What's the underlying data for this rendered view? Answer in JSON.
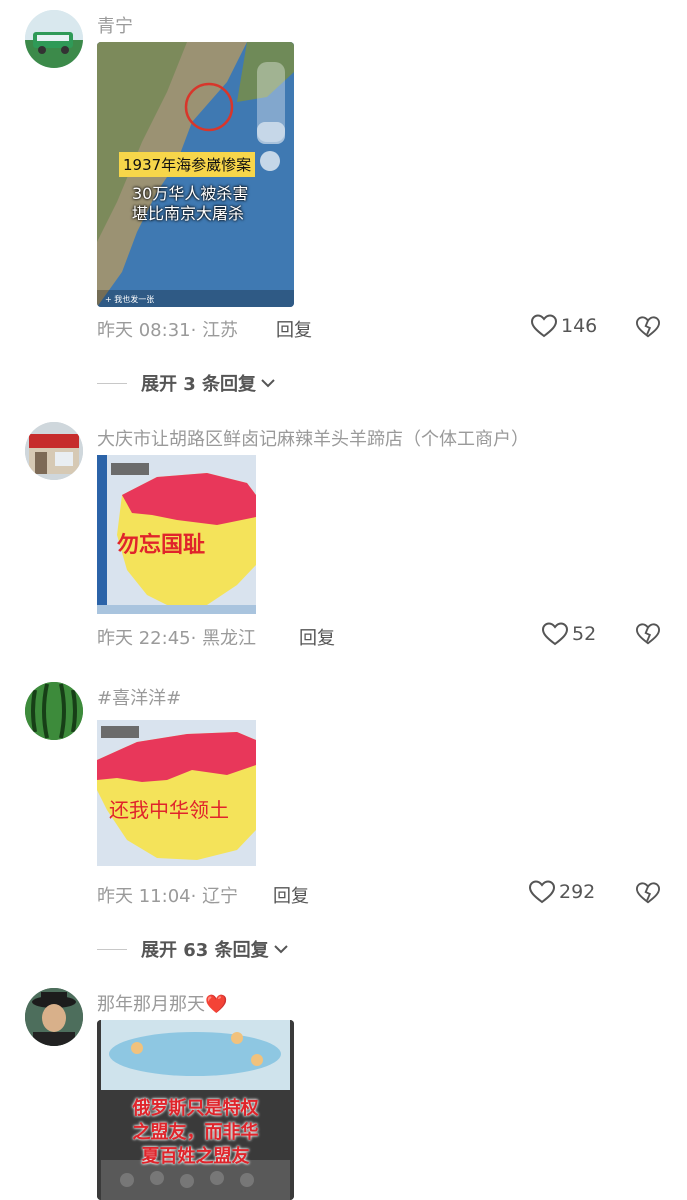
{
  "comments": [
    {
      "username": "青宁",
      "image": {
        "banner": "1937年海参崴惨案",
        "line2": "30万华人被杀害",
        "line3": "堪比南京大屠杀",
        "footer": "+ 我也发一张"
      },
      "time": "昨天 08:31",
      "location": "江苏",
      "reply_label": "回复",
      "likes": "146",
      "expand_label": "展开 3 条回复"
    },
    {
      "username": "大庆市让胡路区鲜卤记麻辣羊头羊蹄店（个体工商户）",
      "image": {
        "map_caption": "勿忘国耻"
      },
      "time": "昨天 22:45",
      "location": "黑龙江",
      "reply_label": "回复",
      "likes": "52"
    },
    {
      "username": "#喜洋洋#",
      "image": {
        "map_caption": "还我中华领土"
      },
      "time": "昨天 11:04",
      "location": "辽宁",
      "reply_label": "回复",
      "likes": "292",
      "expand_label": "展开 63 条回复"
    },
    {
      "username": "那年那月那天",
      "username_emoji": "❤️",
      "image": {
        "line1": "俄罗斯只是特权",
        "line2": "之盟友，而非华",
        "line3": "夏百姓之盟友"
      }
    }
  ],
  "colors": {
    "secondary_text": "#9a9a9a",
    "action_text": "#555555",
    "map_red": "#e8375a",
    "map_yellow": "#f4e35a",
    "caption_red": "#e0242b",
    "banner_yellow": "#f7d64a"
  }
}
